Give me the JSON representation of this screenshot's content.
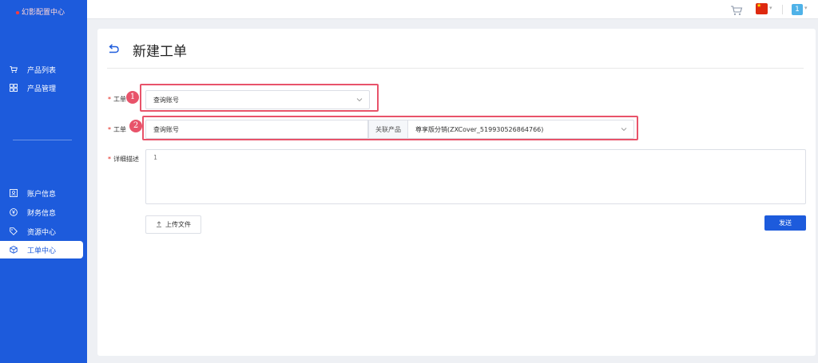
{
  "app": {
    "logo_text": "幻影配置中心"
  },
  "sidebar": {
    "items_top": [
      {
        "label": "产品列表",
        "icon": "cart-icon"
      },
      {
        "label": "产品管理",
        "icon": "grid-icon"
      }
    ],
    "items_bottom": [
      {
        "label": "账户信息",
        "icon": "user-card-icon"
      },
      {
        "label": "财务信息",
        "icon": "yen-icon"
      },
      {
        "label": "资源中心",
        "icon": "tag-icon"
      },
      {
        "label": "工单中心",
        "icon": "cube-icon",
        "active": true
      }
    ]
  },
  "topbar": {
    "avatar_text": "1",
    "language_flag": "cn-flag-icon"
  },
  "page": {
    "title": "新建工单"
  },
  "form": {
    "type_label": "工单",
    "type_select_value": "查询账号",
    "account_label": "工单",
    "account_input_value": "查询账号",
    "product_addon_label": "关联产品",
    "product_select_value": "尊享版分销(ZXCover_519930526864766)",
    "description_label": "详细描述",
    "description_value": "1",
    "upload_label": "上传文件",
    "send_label": "发送"
  },
  "annotations": {
    "badge_1": "1",
    "badge_2": "2"
  },
  "colors": {
    "brand": "#1d5bdc",
    "highlight": "#e8536a",
    "required": "#e2231a"
  }
}
